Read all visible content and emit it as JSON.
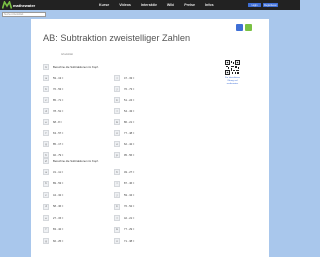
{
  "brand": {
    "name": "mathewater",
    "color": "#7ac143"
  },
  "nav": [
    "Kurse",
    "Videos",
    "Interaktiv",
    "Wiki",
    "Preise",
    "Infos"
  ],
  "auth": {
    "login": "Login",
    "register": "Registrieren"
  },
  "search": {
    "placeholder": "Suche Arbeitsblatt"
  },
  "page": {
    "title": "AB: Subtraktion zweistelliger Zahlen",
    "byline": "Arbeitsblatt",
    "qr_label": "Zur interaktiven Übung auf mathewater"
  },
  "sections": [
    {
      "num": "1",
      "instruction": "Berechne die Subtraktionen im Kopf.",
      "left": [
        {
          "letter": "a",
          "expr": "59 - 13 ="
        },
        {
          "letter": "b",
          "expr": "76 - 53 ="
        },
        {
          "letter": "c",
          "expr": "85 - 71 ="
        },
        {
          "letter": "d",
          "expr": "78 - 51 ="
        },
        {
          "letter": "e",
          "expr": "68 - 8 ="
        },
        {
          "letter": "f",
          "expr": "63 - 57 ="
        },
        {
          "letter": "g",
          "expr": "85 - 17 ="
        },
        {
          "letter": "h",
          "expr": "92 - 79 ="
        }
      ],
      "right": [
        {
          "letter": "i",
          "expr": "47 - 33 ="
        },
        {
          "letter": "j",
          "expr": "76 - 73 ="
        },
        {
          "letter": "k",
          "expr": "51 - 24 ="
        },
        {
          "letter": "l",
          "expr": "54 - 43 ="
        },
        {
          "letter": "m",
          "expr": "86 - 21 ="
        },
        {
          "letter": "n",
          "expr": "77 - 48 ="
        },
        {
          "letter": "o",
          "expr": "62 - 42 ="
        },
        {
          "letter": "p",
          "expr": "95 - 56 ="
        }
      ]
    },
    {
      "num": "2",
      "instruction": "Berechne die Subtraktionen im Kopf.",
      "left": [
        {
          "letter": "a",
          "expr": "31 - 11 ="
        },
        {
          "letter": "b",
          "expr": "89 - 53 ="
        },
        {
          "letter": "c",
          "expr": "44 - 32 ="
        },
        {
          "letter": "d",
          "expr": "58 - 36 ="
        },
        {
          "letter": "e",
          "expr": "27 - 15 ="
        },
        {
          "letter": "f",
          "expr": "83 - 42 ="
        },
        {
          "letter": "g",
          "expr": "66 - 25 ="
        }
      ],
      "right": [
        {
          "letter": "h",
          "expr": "49 - 27 ="
        },
        {
          "letter": "i",
          "expr": "87 - 46 ="
        },
        {
          "letter": "j",
          "expr": "59 - 34 ="
        },
        {
          "letter": "k",
          "expr": "76 - 52 ="
        },
        {
          "letter": "l",
          "expr": "42 - 21 ="
        },
        {
          "letter": "m",
          "expr": "77 - 29 ="
        },
        {
          "letter": "n",
          "expr": "71 - 38 ="
        }
      ]
    }
  ]
}
